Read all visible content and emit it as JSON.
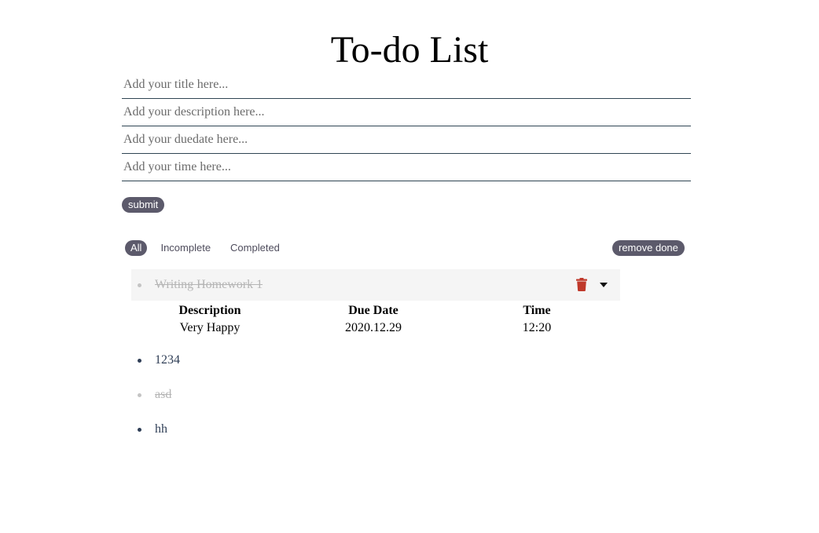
{
  "page": {
    "title": "To-do List"
  },
  "form": {
    "title_placeholder": "Add your title here...",
    "description_placeholder": "Add your description here...",
    "duedate_placeholder": "Add your duedate here...",
    "time_placeholder": "Add your time here...",
    "submit_label": "submit"
  },
  "filters": {
    "all": "All",
    "incomplete": "Incomplete",
    "completed": "Completed",
    "active": "All"
  },
  "actions": {
    "remove_done_label": "remove done"
  },
  "details_headers": {
    "description": "Description",
    "due_date": "Due Date",
    "time": "Time"
  },
  "todos": [
    {
      "title": "Writing Homework 1",
      "done": true,
      "expanded": true,
      "description": "Very Happy",
      "due_date": "2020.12.29",
      "time": "12:20"
    },
    {
      "title": "1234",
      "done": false,
      "expanded": false
    },
    {
      "title": "asd",
      "done": true,
      "expanded": false
    },
    {
      "title": "hh",
      "done": false,
      "expanded": false
    }
  ],
  "colors": {
    "pill_bg": "#5c5a6b",
    "trash": "#c0392b",
    "done_text": "#b5b5b5",
    "text": "#2f3e56"
  },
  "icons": {
    "delete": "trash-icon",
    "expand": "caret-down-icon"
  }
}
